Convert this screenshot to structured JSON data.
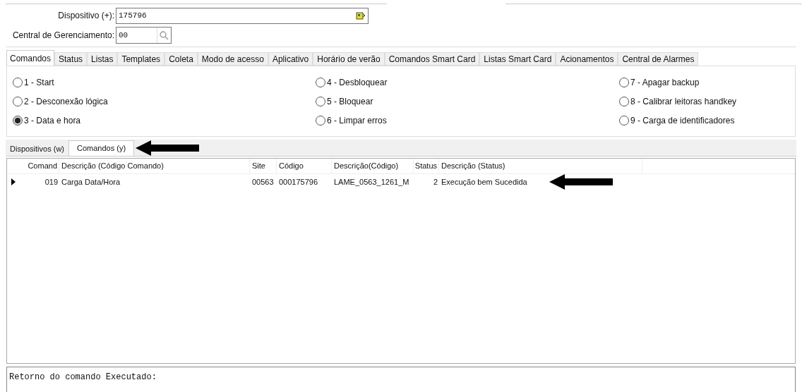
{
  "form": {
    "device_label": "Dispositivo (+):",
    "device_value": "175796",
    "central_label": "Central de Gerenciamento:",
    "central_value": "00"
  },
  "tabs": [
    {
      "label": "Comandos",
      "selected": true
    },
    {
      "label": "Status",
      "selected": false
    },
    {
      "label": "Listas",
      "selected": false
    },
    {
      "label": "Templates",
      "selected": false
    },
    {
      "label": "Coleta",
      "selected": false
    },
    {
      "label": "Modo de acesso",
      "selected": false
    },
    {
      "label": "Aplicativo",
      "selected": false
    },
    {
      "label": "Horário de verão",
      "selected": false
    },
    {
      "label": "Comandos Smart Card",
      "selected": false
    },
    {
      "label": "Listas Smart Card",
      "selected": false
    },
    {
      "label": "Acionamentos",
      "selected": false
    },
    {
      "label": "Central de Alarmes",
      "selected": false
    }
  ],
  "commands": [
    {
      "label": "1 - Start",
      "selected": false
    },
    {
      "label": "2 - Desconexão lógica",
      "selected": false
    },
    {
      "label": "3 - Data e hora",
      "selected": true
    },
    {
      "label": "4 - Desbloquear",
      "selected": false
    },
    {
      "label": "5 - Bloquear",
      "selected": false
    },
    {
      "label": "6 - Limpar erros",
      "selected": false
    },
    {
      "label": "7 - Apagar backup",
      "selected": false
    },
    {
      "label": "8 - Calibrar leitoras handkey",
      "selected": false
    },
    {
      "label": "9 - Carga de identificadores",
      "selected": false
    }
  ],
  "bottom_tabs": [
    {
      "label": "Dispositivos (w)",
      "selected": false
    },
    {
      "label": "Comandos (y)",
      "selected": true
    }
  ],
  "table": {
    "columns": [
      {
        "label": "Comand"
      },
      {
        "label": "Descrição (Código Comando)"
      },
      {
        "label": "Site"
      },
      {
        "label": "Código"
      },
      {
        "label": "Descrição(Código)"
      },
      {
        "label": "Status"
      },
      {
        "label": "Descrição (Status)"
      }
    ],
    "rows": [
      {
        "current": true,
        "cells": [
          "019",
          "Carga Data/Hora",
          "00563",
          "000175796",
          "LAME_0563_1261_M",
          "2",
          "Execução bem Sucedida"
        ]
      }
    ]
  },
  "output": {
    "value": "Retorno do comando Executado:"
  }
}
